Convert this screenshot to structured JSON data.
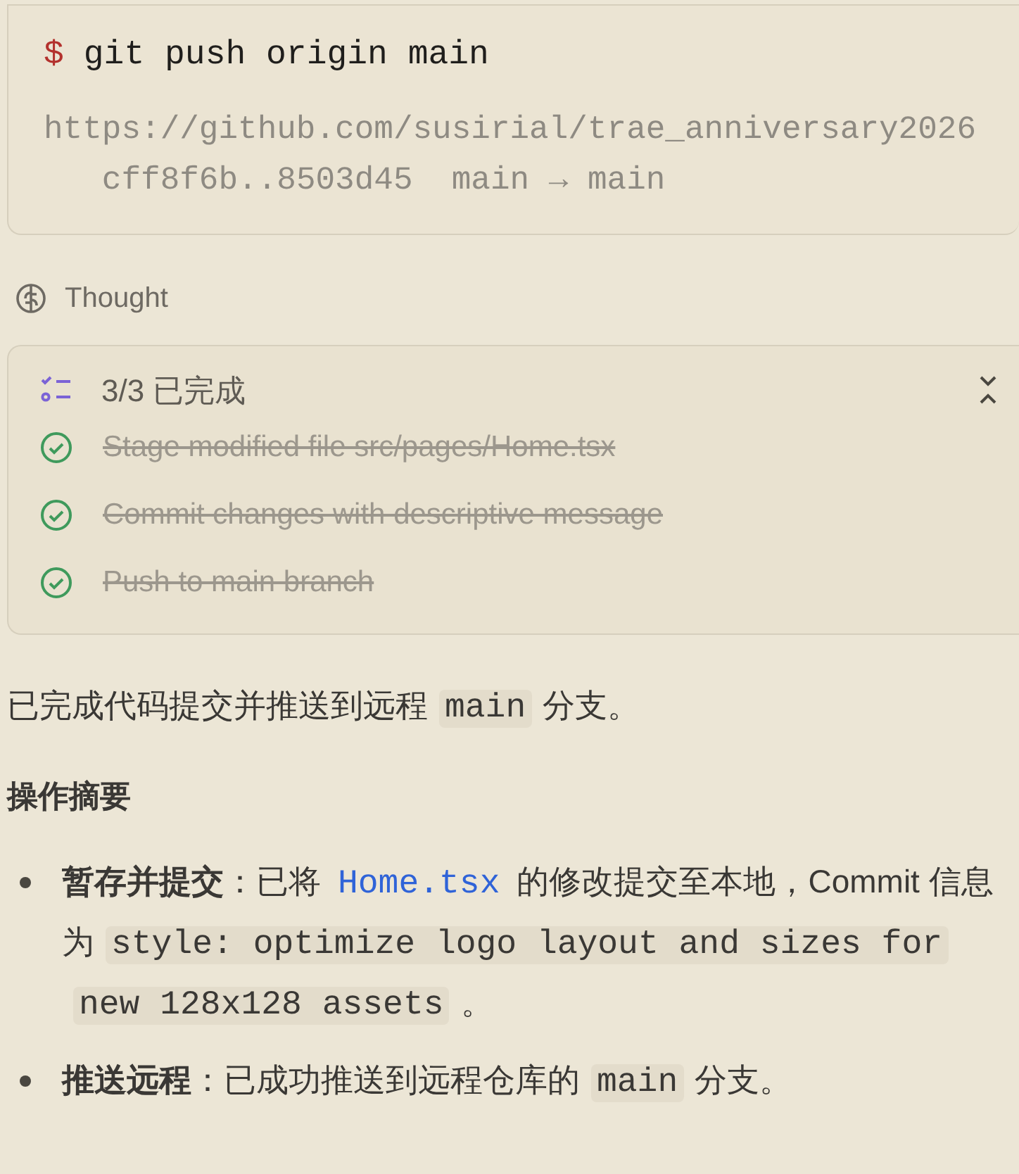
{
  "terminal": {
    "prompt": "$",
    "command": "git push origin main",
    "output": [
      "https://github.com/susirial/trae_anniversary2026",
      "   cff8f6b..8503d45  main → main"
    ]
  },
  "thought": {
    "label": "Thought"
  },
  "todo": {
    "title": "3/3 已完成",
    "expanded": true,
    "items": [
      {
        "text": "Stage modified file src/pages/Home.tsx",
        "checked": true
      },
      {
        "text": "Commit changes with descriptive message",
        "checked": true
      },
      {
        "text": "Push to main branch",
        "checked": true
      }
    ]
  },
  "summary": [
    {
      "kind": "text",
      "text": "已完成代码提交并推送到远程"
    },
    {
      "kind": "code",
      "text": "main"
    },
    {
      "kind": "text",
      "text": "分支。"
    }
  ],
  "heading": "操作摘要",
  "bullets": [
    [
      {
        "kind": "bold",
        "text": "暂存并提交"
      },
      {
        "kind": "text",
        "text": "：已将"
      },
      {
        "kind": "link",
        "text": "Home.tsx"
      },
      {
        "kind": "text",
        "text": "的修改提交至本地，Commit 信息为"
      },
      {
        "kind": "code",
        "text": "style: optimize logo layout and sizes for new 128x128 assets"
      },
      {
        "kind": "text",
        "text": "。"
      }
    ],
    [
      {
        "kind": "bold",
        "text": "推送远程"
      },
      {
        "kind": "text",
        "text": "：已成功推送到远程仓库的"
      },
      {
        "kind": "code",
        "text": "main"
      },
      {
        "kind": "text",
        "text": "分支。"
      }
    ]
  ]
}
